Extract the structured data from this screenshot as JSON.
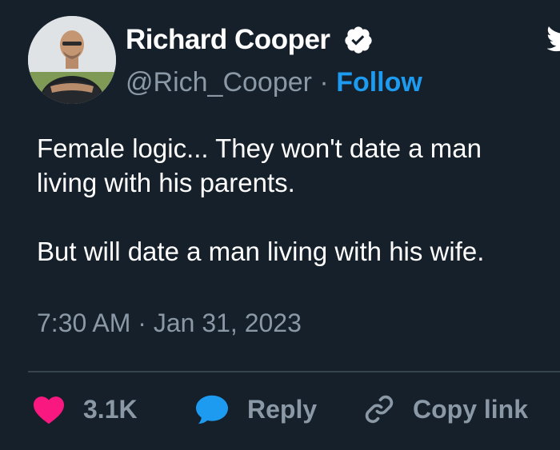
{
  "author": {
    "name": "Richard Cooper",
    "handle": "@Rich_Cooper",
    "separator": "·",
    "follow_label": "Follow",
    "avatar_icon": "profile-photo-avatar",
    "verified_icon": "verified-badge-icon"
  },
  "tweet": {
    "text": "Female logic... They won't date a man\nliving with his parents.\n\nBut will date a man living with his wife.",
    "timestamp": "7:30 AM · Jan 31, 2023"
  },
  "actions": {
    "like": {
      "icon": "heart-icon",
      "count": "3.1K",
      "color": "#f91880"
    },
    "reply": {
      "icon": "speech-bubble-icon",
      "label": "Reply",
      "color": "#1d9bf0"
    },
    "copy_link": {
      "icon": "link-icon",
      "label": "Copy link"
    }
  },
  "colors": {
    "background": "#15202b",
    "text": "#ffffff",
    "secondary_text": "#8b98a5",
    "accent": "#1d9bf0",
    "divider": "#38444d"
  }
}
